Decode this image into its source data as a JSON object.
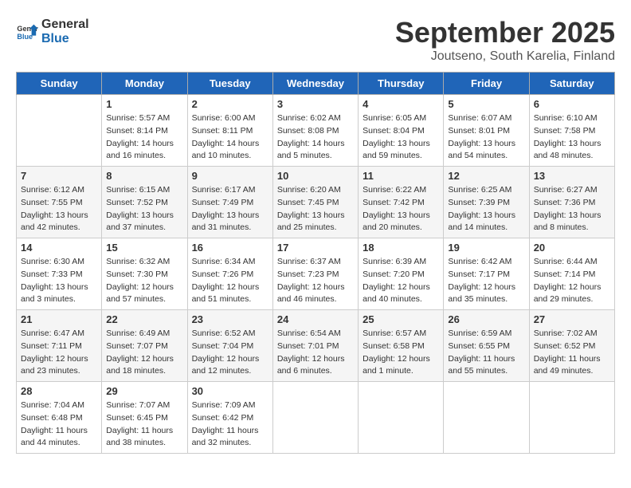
{
  "header": {
    "logo_line1": "General",
    "logo_line2": "Blue",
    "month_title": "September 2025",
    "location": "Joutseno, South Karelia, Finland"
  },
  "days_of_week": [
    "Sunday",
    "Monday",
    "Tuesday",
    "Wednesday",
    "Thursday",
    "Friday",
    "Saturday"
  ],
  "weeks": [
    [
      {
        "day": "",
        "sunrise": "",
        "sunset": "",
        "daylight": ""
      },
      {
        "day": "1",
        "sunrise": "Sunrise: 5:57 AM",
        "sunset": "Sunset: 8:14 PM",
        "daylight": "Daylight: 14 hours and 16 minutes."
      },
      {
        "day": "2",
        "sunrise": "Sunrise: 6:00 AM",
        "sunset": "Sunset: 8:11 PM",
        "daylight": "Daylight: 14 hours and 10 minutes."
      },
      {
        "day": "3",
        "sunrise": "Sunrise: 6:02 AM",
        "sunset": "Sunset: 8:08 PM",
        "daylight": "Daylight: 14 hours and 5 minutes."
      },
      {
        "day": "4",
        "sunrise": "Sunrise: 6:05 AM",
        "sunset": "Sunset: 8:04 PM",
        "daylight": "Daylight: 13 hours and 59 minutes."
      },
      {
        "day": "5",
        "sunrise": "Sunrise: 6:07 AM",
        "sunset": "Sunset: 8:01 PM",
        "daylight": "Daylight: 13 hours and 54 minutes."
      },
      {
        "day": "6",
        "sunrise": "Sunrise: 6:10 AM",
        "sunset": "Sunset: 7:58 PM",
        "daylight": "Daylight: 13 hours and 48 minutes."
      }
    ],
    [
      {
        "day": "7",
        "sunrise": "Sunrise: 6:12 AM",
        "sunset": "Sunset: 7:55 PM",
        "daylight": "Daylight: 13 hours and 42 minutes."
      },
      {
        "day": "8",
        "sunrise": "Sunrise: 6:15 AM",
        "sunset": "Sunset: 7:52 PM",
        "daylight": "Daylight: 13 hours and 37 minutes."
      },
      {
        "day": "9",
        "sunrise": "Sunrise: 6:17 AM",
        "sunset": "Sunset: 7:49 PM",
        "daylight": "Daylight: 13 hours and 31 minutes."
      },
      {
        "day": "10",
        "sunrise": "Sunrise: 6:20 AM",
        "sunset": "Sunset: 7:45 PM",
        "daylight": "Daylight: 13 hours and 25 minutes."
      },
      {
        "day": "11",
        "sunrise": "Sunrise: 6:22 AM",
        "sunset": "Sunset: 7:42 PM",
        "daylight": "Daylight: 13 hours and 20 minutes."
      },
      {
        "day": "12",
        "sunrise": "Sunrise: 6:25 AM",
        "sunset": "Sunset: 7:39 PM",
        "daylight": "Daylight: 13 hours and 14 minutes."
      },
      {
        "day": "13",
        "sunrise": "Sunrise: 6:27 AM",
        "sunset": "Sunset: 7:36 PM",
        "daylight": "Daylight: 13 hours and 8 minutes."
      }
    ],
    [
      {
        "day": "14",
        "sunrise": "Sunrise: 6:30 AM",
        "sunset": "Sunset: 7:33 PM",
        "daylight": "Daylight: 13 hours and 3 minutes."
      },
      {
        "day": "15",
        "sunrise": "Sunrise: 6:32 AM",
        "sunset": "Sunset: 7:30 PM",
        "daylight": "Daylight: 12 hours and 57 minutes."
      },
      {
        "day": "16",
        "sunrise": "Sunrise: 6:34 AM",
        "sunset": "Sunset: 7:26 PM",
        "daylight": "Daylight: 12 hours and 51 minutes."
      },
      {
        "day": "17",
        "sunrise": "Sunrise: 6:37 AM",
        "sunset": "Sunset: 7:23 PM",
        "daylight": "Daylight: 12 hours and 46 minutes."
      },
      {
        "day": "18",
        "sunrise": "Sunrise: 6:39 AM",
        "sunset": "Sunset: 7:20 PM",
        "daylight": "Daylight: 12 hours and 40 minutes."
      },
      {
        "day": "19",
        "sunrise": "Sunrise: 6:42 AM",
        "sunset": "Sunset: 7:17 PM",
        "daylight": "Daylight: 12 hours and 35 minutes."
      },
      {
        "day": "20",
        "sunrise": "Sunrise: 6:44 AM",
        "sunset": "Sunset: 7:14 PM",
        "daylight": "Daylight: 12 hours and 29 minutes."
      }
    ],
    [
      {
        "day": "21",
        "sunrise": "Sunrise: 6:47 AM",
        "sunset": "Sunset: 7:11 PM",
        "daylight": "Daylight: 12 hours and 23 minutes."
      },
      {
        "day": "22",
        "sunrise": "Sunrise: 6:49 AM",
        "sunset": "Sunset: 7:07 PM",
        "daylight": "Daylight: 12 hours and 18 minutes."
      },
      {
        "day": "23",
        "sunrise": "Sunrise: 6:52 AM",
        "sunset": "Sunset: 7:04 PM",
        "daylight": "Daylight: 12 hours and 12 minutes."
      },
      {
        "day": "24",
        "sunrise": "Sunrise: 6:54 AM",
        "sunset": "Sunset: 7:01 PM",
        "daylight": "Daylight: 12 hours and 6 minutes."
      },
      {
        "day": "25",
        "sunrise": "Sunrise: 6:57 AM",
        "sunset": "Sunset: 6:58 PM",
        "daylight": "Daylight: 12 hours and 1 minute."
      },
      {
        "day": "26",
        "sunrise": "Sunrise: 6:59 AM",
        "sunset": "Sunset: 6:55 PM",
        "daylight": "Daylight: 11 hours and 55 minutes."
      },
      {
        "day": "27",
        "sunrise": "Sunrise: 7:02 AM",
        "sunset": "Sunset: 6:52 PM",
        "daylight": "Daylight: 11 hours and 49 minutes."
      }
    ],
    [
      {
        "day": "28",
        "sunrise": "Sunrise: 7:04 AM",
        "sunset": "Sunset: 6:48 PM",
        "daylight": "Daylight: 11 hours and 44 minutes."
      },
      {
        "day": "29",
        "sunrise": "Sunrise: 7:07 AM",
        "sunset": "Sunset: 6:45 PM",
        "daylight": "Daylight: 11 hours and 38 minutes."
      },
      {
        "day": "30",
        "sunrise": "Sunrise: 7:09 AM",
        "sunset": "Sunset: 6:42 PM",
        "daylight": "Daylight: 11 hours and 32 minutes."
      },
      {
        "day": "",
        "sunrise": "",
        "sunset": "",
        "daylight": ""
      },
      {
        "day": "",
        "sunrise": "",
        "sunset": "",
        "daylight": ""
      },
      {
        "day": "",
        "sunrise": "",
        "sunset": "",
        "daylight": ""
      },
      {
        "day": "",
        "sunrise": "",
        "sunset": "",
        "daylight": ""
      }
    ]
  ]
}
